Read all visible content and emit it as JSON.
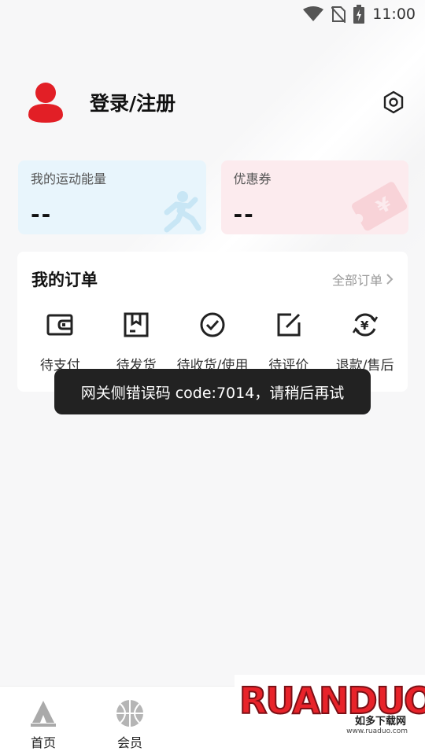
{
  "status_bar": {
    "time": "11:00"
  },
  "profile": {
    "login_label": "登录/注册"
  },
  "cards": {
    "energy": {
      "title": "我的运动能量",
      "value": "--"
    },
    "coupon": {
      "title": "优惠券",
      "value": "--"
    }
  },
  "orders": {
    "title": "我的订单",
    "all_label": "全部订单",
    "items": [
      {
        "label": "待支付",
        "icon": "wallet-icon"
      },
      {
        "label": "待发货",
        "icon": "box-icon"
      },
      {
        "label": "待收货/使用",
        "icon": "check-circle-icon"
      },
      {
        "label": "待评价",
        "icon": "edit-icon"
      },
      {
        "label": "退款/售后",
        "icon": "yen-refund-icon"
      }
    ]
  },
  "toast": {
    "message": "网关侧错误码 code:7014，请稍后再试"
  },
  "bottom_nav": {
    "items": [
      {
        "label": "首页",
        "icon": "home-logo-icon"
      },
      {
        "label": "会员",
        "icon": "basketball-icon"
      }
    ]
  },
  "watermark": {
    "brand": "RUANDUO",
    "sub": "如多下载网",
    "url": "www.ruaduo.com"
  },
  "colors": {
    "accent": "#e8232a",
    "energy_bg": "#e8f5fc",
    "coupon_bg": "#fcebee",
    "toast_bg": "#222222"
  }
}
